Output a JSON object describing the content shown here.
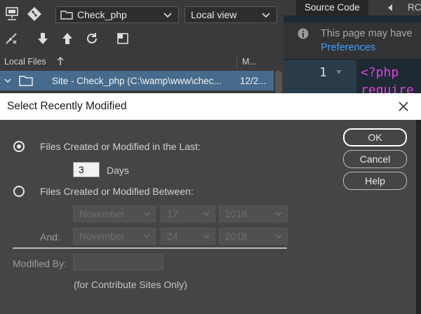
{
  "files_panel": {
    "site_name": "Check_php",
    "view_mode": "Local view",
    "column_local_files": "Local Files",
    "column_modified": "M...",
    "site_row_label": "Site - Check_php (C:\\wamp\\www\\chec...",
    "site_row_modified": "12/2..."
  },
  "code_panel": {
    "tab_source": "Source Code",
    "tab_rc": "RC",
    "info_text": "This page may have",
    "info_link": "Preferences",
    "line_number": "1",
    "code_line1": "<?php",
    "code_line2": "require"
  },
  "dialog": {
    "title": "Select Recently Modified",
    "option_last_label": "Files Created or Modified in the Last:",
    "days_value": "3",
    "days_unit": "Days",
    "option_between_label": "Files Created or Modified Between:",
    "from_month": "November",
    "from_day": "17",
    "from_year": "2018",
    "and_label": "And:",
    "to_month": "November",
    "to_day": "24",
    "to_year": "2018",
    "modified_by_label": "Modified By:",
    "contribute_note": "(for Contribute Sites Only)",
    "ok_label": "OK",
    "cancel_label": "Cancel",
    "help_label": "Help"
  },
  "colors": {
    "selection": "#466b8c",
    "dialog_bg": "#454545",
    "link": "#3aa0ff",
    "code_keyword": "#e040e0"
  }
}
